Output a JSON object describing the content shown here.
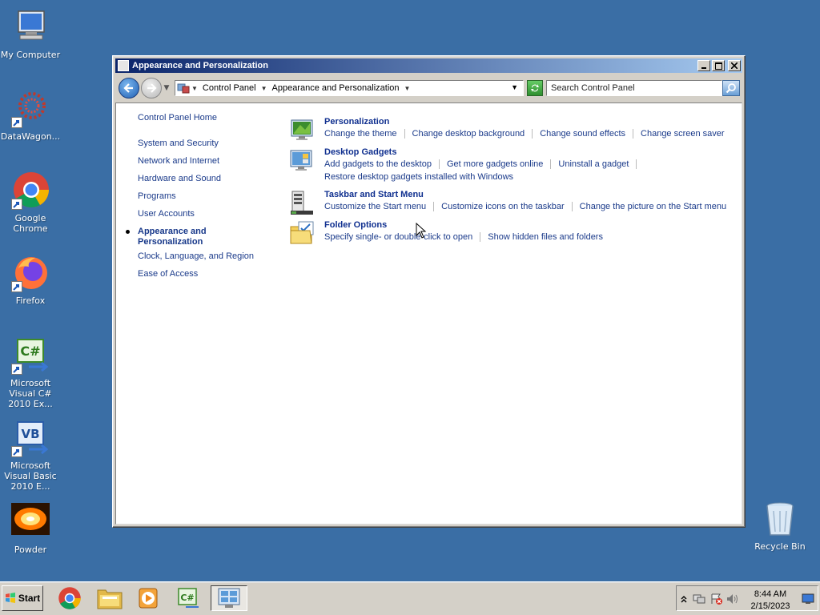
{
  "desktop": {
    "icons": [
      {
        "label": "My Computer"
      },
      {
        "label": "DataWagon..."
      },
      {
        "label": "Google Chrome"
      },
      {
        "label": "Firefox"
      },
      {
        "label": "Microsoft Visual C# 2010 Ex..."
      },
      {
        "label": "Microsoft Visual Basic 2010 E..."
      },
      {
        "label": "Powder"
      },
      {
        "label": "Recycle Bin"
      }
    ]
  },
  "window": {
    "title": "Appearance and Personalization",
    "breadcrumb": [
      "Control Panel",
      "Appearance and Personalization"
    ],
    "search_placeholder": "Search Control Panel",
    "nav": {
      "home": "Control Panel Home",
      "items": [
        "System and Security",
        "Network and Internet",
        "Hardware and Sound",
        "Programs",
        "User Accounts",
        "Appearance and Personalization",
        "Clock, Language, and Region",
        "Ease of Access"
      ],
      "current_index": 5
    },
    "sections": [
      {
        "title": "Personalization",
        "icon": "personalization-icon",
        "links": [
          [
            "Change the theme",
            "Change desktop background",
            "Change sound effects",
            "Change screen saver"
          ]
        ]
      },
      {
        "title": "Desktop Gadgets",
        "icon": "gadgets-icon",
        "links": [
          [
            "Add gadgets to the desktop",
            "Get more gadgets online",
            "Uninstall a gadget",
            ""
          ],
          [
            "Restore desktop gadgets installed with Windows"
          ]
        ]
      },
      {
        "title": "Taskbar and Start Menu",
        "icon": "taskbar-icon",
        "links": [
          [
            "Customize the Start menu",
            "Customize icons on the taskbar",
            "Change the picture on the Start menu"
          ]
        ]
      },
      {
        "title": "Folder Options",
        "icon": "folder-options-icon",
        "links": [
          [
            "Specify single- or double-click to open",
            "Show hidden files and folders"
          ]
        ]
      }
    ]
  },
  "taskbar": {
    "start_label": "Start",
    "time": "8:44 AM",
    "date": "2/15/2023"
  }
}
